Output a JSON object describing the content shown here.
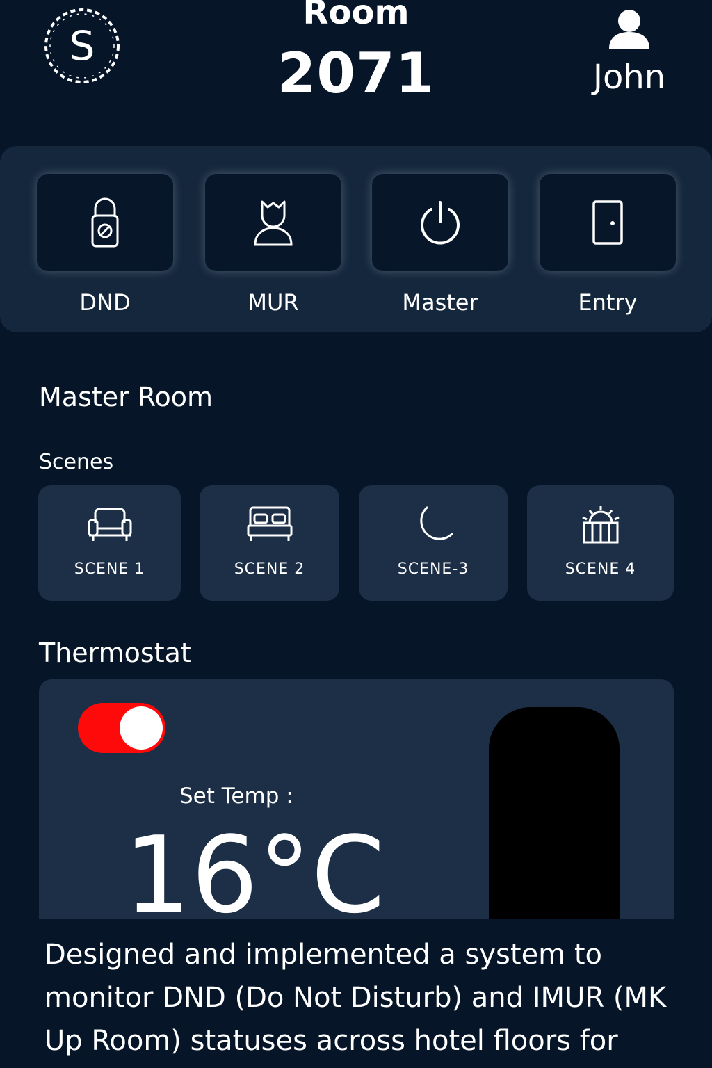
{
  "header": {
    "logo_letter": "S",
    "room_label": "Room",
    "room_number": "2071",
    "user_name": "John"
  },
  "status_buttons": [
    {
      "label": "DND",
      "icon": "dnd-lock-icon"
    },
    {
      "label": "MUR",
      "icon": "housekeeping-person-icon"
    },
    {
      "label": "Master",
      "icon": "power-icon"
    },
    {
      "label": "Entry",
      "icon": "door-icon"
    }
  ],
  "main": {
    "section_title": "Master Room",
    "scenes_title": "Scenes",
    "scenes": [
      {
        "label": "SCENE 1",
        "icon": "sofa-icon"
      },
      {
        "label": "SCENE 2",
        "icon": "bed-icon"
      },
      {
        "label": "SCENE-3",
        "icon": "moon-icon"
      },
      {
        "label": "SCENE 4",
        "icon": "sunrise-icon"
      }
    ],
    "thermostat_title": "Thermostat"
  },
  "thermostat": {
    "power_on": true,
    "toggle_color": "#ff0a0a",
    "set_temp_label": "Set Temp :",
    "temperature": "16°C"
  },
  "caption": "Designed and implemented a system to monitor DND (Do Not Disturb) and IMUR (MK Up Room) statuses across hotel floors for",
  "colors": {
    "background": "#061528",
    "panel": "#15273c",
    "card": "#1c2f46",
    "button": "#071729"
  }
}
